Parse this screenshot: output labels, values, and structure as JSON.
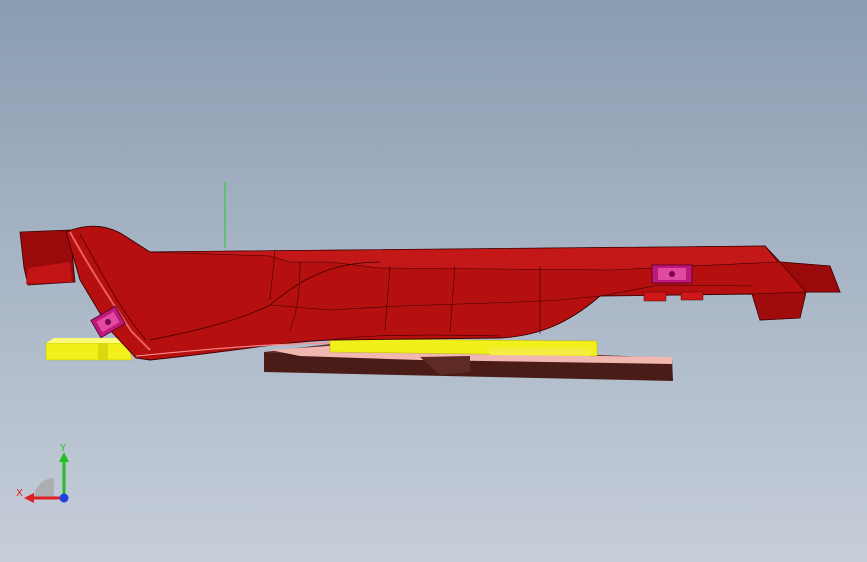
{
  "viewport": {
    "background_top": "#8a9cb1",
    "background_bottom": "#c6ced9"
  },
  "model": {
    "part_color": "#b50f0f",
    "part_shadow": "#7a0606",
    "fixture_yellow": "#f2f01a",
    "plate_pink": "#f0b8b0",
    "plate_brown": "#4a1c18",
    "clamp_magenta": "#c0187a",
    "origin_axis_color": "#22cc22"
  },
  "triad": {
    "x_label": "X",
    "y_label": "Y",
    "x_color": "#e02020",
    "y_color": "#20c020",
    "z_color": "#2040e0"
  }
}
